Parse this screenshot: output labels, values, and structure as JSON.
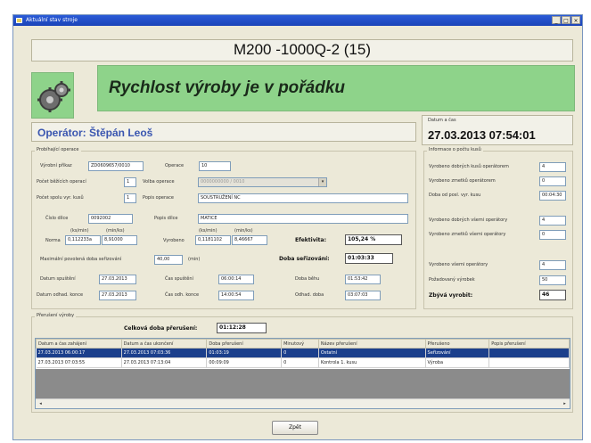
{
  "window": {
    "title": "Aktuální stav stroje",
    "controls": {
      "minimize": "_",
      "maximize": "□",
      "close": "×"
    }
  },
  "machine": {
    "name": "M200 -1000Q-2 (15)"
  },
  "status": {
    "message": "Rychlost výroby je v pořádku",
    "color": "#8ed38a"
  },
  "operator": {
    "label": "Operátor: Štěpán Leoš"
  },
  "datetime": {
    "label": "Datum a čas",
    "value": "27.03.2013 07:54:01"
  },
  "operation": {
    "legend": "Probíhající operace",
    "vyrobni_prikaz_label": "Výrobní příkaz",
    "vyrobni_prikaz": "ZD0609657/0010",
    "operace_label": "Operace",
    "operace": "10",
    "pocet_behu_label": "Počet běžících operací",
    "pocet_behu": "1",
    "volba_operace_label": "Volba operace",
    "volba_operace": "0000000000 / 0010",
    "pocet_kusu_label": "Počet spolu vyr. kusů",
    "pocet_kusu": "1",
    "popis_operace_label": "Popis operace",
    "popis_operace": "SOUSTRUŽENÍ NC",
    "cislo_dilce_label": "Číslo dílce",
    "cislo_dilce": "0092002",
    "popis_dilce_label": "Popis dílce",
    "popis_dilce": "MATICE",
    "norma_label": "Norma",
    "vyrobeno_label": "Vyrobeno",
    "unit_ks_hod": "(ks/min)",
    "unit_min_ks": "(min/ks)",
    "norma_1": "0,112233a",
    "norma_2": "8,91000",
    "vyrobeno_1": "0,1181102",
    "vyrobeno_2": "8,46667",
    "efektivita_label": "Efektivita:",
    "efektivita": "105,24 %",
    "max_doba_label": "Maximální povolená doba seřizování",
    "max_doba": "40,00",
    "max_doba_unit": "(min)",
    "doba_serizovani_label": "Doba seřizování:",
    "doba_serizovani": "01:03:33",
    "datum_spusteni_label": "Datum spuštění",
    "datum_spusteni": "27.03.2013",
    "cas_spusteni_label": "Čas spuštění",
    "cas_spusteni": "06:00:14",
    "doba_behu_label": "Doba běhu",
    "doba_behu": "01:53:42",
    "datum_konce_label": "Datum odhad. konce",
    "datum_konce": "27.03.2013",
    "cas_konce_label": "Čas odh. konce",
    "cas_konce": "14:00:54",
    "odhad_doba_label": "Odhad. doba",
    "odhad_doba": "03:07:03"
  },
  "pieces": {
    "legend": "Informace o počtu kusů",
    "dobre_label": "Vyrobeno dobrých kusů operátorem",
    "dobre": "4",
    "zmetky_label": "Vyrobeno zmetků operátorem",
    "zmetky": "0",
    "doba_label": "Doba od posl. vyr. kusu",
    "doba": "00:04:30",
    "dobre_vsemi_label": "Vyrobeno dobrých všemi operátory",
    "dobre_vsemi": "4",
    "zmetky_vsemi_label": "Vyrobeno zmetků všemi operátory",
    "zmetky_vsemi": "0",
    "vsemi_label": "Vyrobeno všemi operátory",
    "vsemi": "4",
    "pozadovano_label": "Požadovaný výrobek",
    "pozadovano": "50",
    "zbyva_label": "Zbývá vyrobit:",
    "zbyva": "46"
  },
  "interruptions": {
    "legend": "Přerušení výroby",
    "total_label": "Celková doba přerušení:",
    "total": "01:12:28",
    "columns": [
      "Datum a čas zahájení",
      "Datum a čas ukončení",
      "Doba přerušení",
      "Minutový",
      "Název přerušení",
      "Přerušeno",
      "Popis přerušení"
    ],
    "rows": [
      [
        "27.03.2013 06:00:17",
        "27.03.2013 07:03:36",
        "01:03:19",
        "0",
        "Ostatní",
        "Seřizování",
        ""
      ],
      [
        "27.03.2013 07:03:55",
        "27.03.2013 07:13:04",
        "00:09:09",
        "0",
        "Kontrola 1. kusu",
        "Výroba",
        ""
      ]
    ],
    "scroll_left": "◂",
    "scroll_right": "▸"
  },
  "footer": {
    "back_button": "Zpět"
  }
}
